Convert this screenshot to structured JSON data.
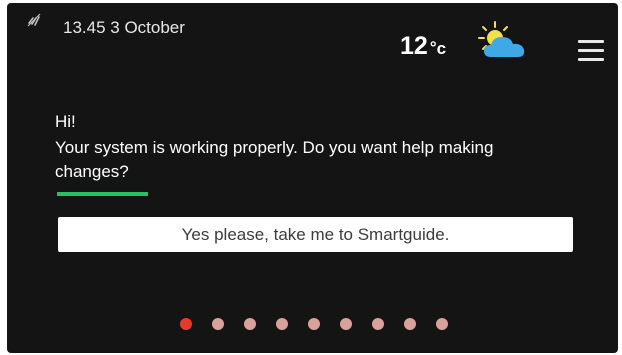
{
  "status_bar": {
    "clock": "13.45 3 October",
    "signal_icon": "wifi-signal-icon"
  },
  "weather": {
    "temperature": "12",
    "degree_symbol": "°",
    "unit": "c",
    "icon": "partly-sunny-icon"
  },
  "menu": {
    "icon": "hamburger-menu-icon"
  },
  "message": {
    "greeting": "Hi!",
    "body": "Your system is working properly. Do you want help making changes?"
  },
  "cta": {
    "label": "Yes please, take me to Smartguide."
  },
  "pagination": {
    "total_pages": 9,
    "current_page": 1
  },
  "colors": {
    "background": "#141414",
    "accent_underline": "#27c165",
    "dot_active": "#e8392b",
    "dot_inactive": "#d9a19c"
  }
}
